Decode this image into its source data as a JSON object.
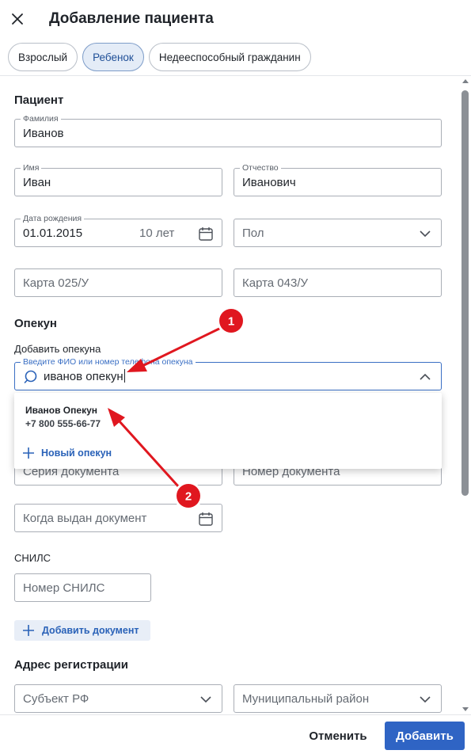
{
  "header": {
    "title": "Добавление пациента"
  },
  "tabs": [
    {
      "label": "Взрослый",
      "active": false
    },
    {
      "label": "Ребенок",
      "active": true
    },
    {
      "label": "Недееспособный гражданин",
      "active": false
    }
  ],
  "patient": {
    "section_title": "Пациент",
    "last_name": {
      "label": "Фамилия",
      "value": "Иванов"
    },
    "first_name": {
      "label": "Имя",
      "value": "Иван"
    },
    "patronymic": {
      "label": "Отчество",
      "value": "Иванович"
    },
    "birth_date": {
      "label": "Дата рождения",
      "value": "01.01.2015",
      "age": "10 лет"
    },
    "gender": {
      "placeholder": "Пол"
    },
    "card_025": {
      "placeholder": "Карта 025/У"
    },
    "card_043": {
      "placeholder": "Карта 043/У"
    }
  },
  "guardian": {
    "section_title": "Опекун",
    "add_label": "Добавить опекуна",
    "search": {
      "label": "Введите ФИО или номер телефона опекуна",
      "value": "иванов опекун"
    },
    "dropdown": {
      "result_name": "Иванов Опекун",
      "result_phone": "+7 800 555-66-77",
      "new_label": "Новый опекун"
    },
    "doc_series": {
      "placeholder": "Серия документа"
    },
    "doc_number": {
      "placeholder": "Номер документа"
    },
    "doc_issued": {
      "placeholder": "Когда выдан документ"
    }
  },
  "snils": {
    "label": "СНИЛС",
    "placeholder": "Номер СНИЛС"
  },
  "add_document_label": "Добавить документ",
  "address": {
    "section_title": "Адрес регистрации",
    "region": {
      "placeholder": "Субъект РФ"
    },
    "district": {
      "placeholder": "Муниципальный район"
    }
  },
  "footer": {
    "cancel_label": "Отменить",
    "submit_label": "Добавить"
  },
  "annotations": [
    {
      "number": "1"
    },
    {
      "number": "2"
    }
  ],
  "colors": {
    "accent": "#2f64c4",
    "annotation_red": "#e0171f",
    "active_tab_bg": "#e4ecf7"
  }
}
